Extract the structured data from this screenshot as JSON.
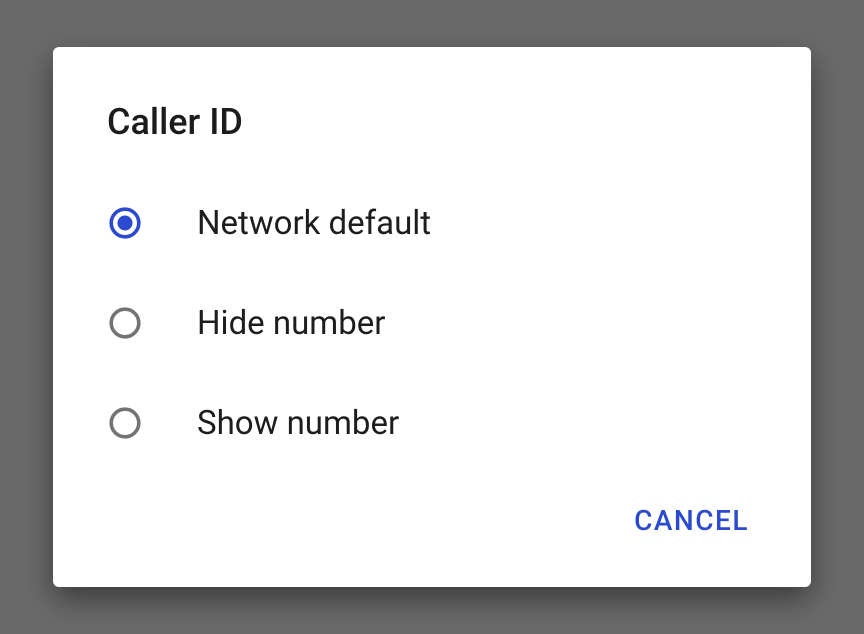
{
  "dialog": {
    "title": "Caller ID",
    "options": [
      {
        "label": "Network default",
        "selected": true
      },
      {
        "label": "Hide number",
        "selected": false
      },
      {
        "label": "Show number",
        "selected": false
      }
    ],
    "cancel_label": "CANCEL"
  },
  "colors": {
    "accent": "#2b4ad0",
    "radio_unchecked": "#737373"
  }
}
